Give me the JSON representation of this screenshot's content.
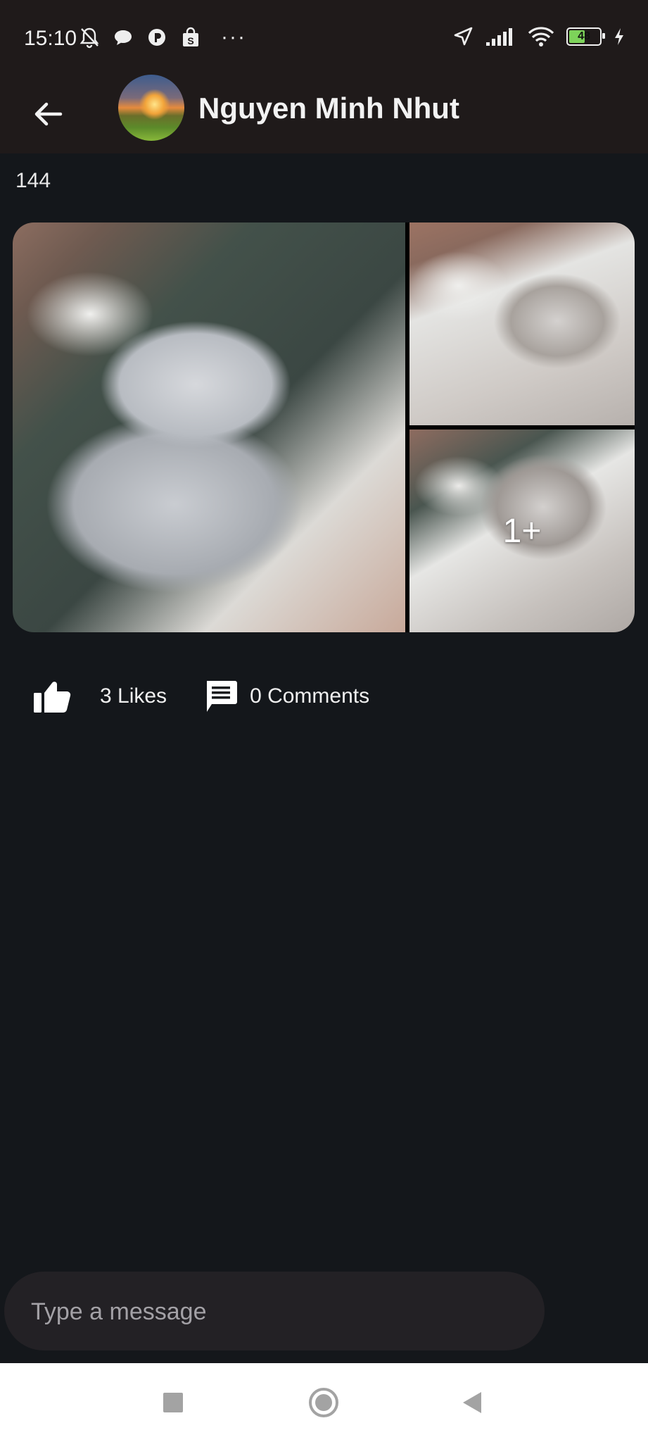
{
  "status_bar": {
    "time": "15:10",
    "left_icons": [
      "bell-off-icon",
      "chat-bubble-icon",
      "circle-p-icon",
      "shopping-bag-icon"
    ],
    "overflow": "···",
    "right_icons": [
      "location-arrow-icon",
      "signal-bars-icon",
      "wifi-icon"
    ],
    "battery_percent": "48"
  },
  "app_bar": {
    "title": "Nguyen Minh Nhut"
  },
  "post": {
    "text": "144",
    "gallery": {
      "extra_count_label": "1+"
    },
    "likes_label": "3 Likes",
    "comments_label": "0 Comments"
  },
  "composer": {
    "placeholder": "Type a message"
  },
  "colors": {
    "background": "#14171b",
    "app_bar": "#1f1a1a",
    "composer": "#232125",
    "battery_fill": "#7dd35a"
  }
}
